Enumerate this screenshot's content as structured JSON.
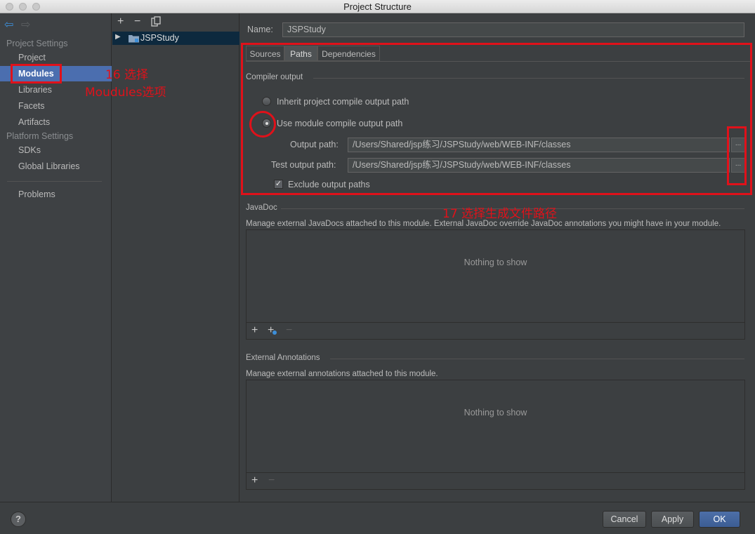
{
  "window": {
    "title": "Project Structure"
  },
  "sidebar": {
    "nav_back_icon": "back-arrow-icon",
    "nav_forward_icon": "forward-arrow-icon",
    "header_project_settings": "Project Settings",
    "header_platform_settings": "Platform Settings",
    "items": [
      {
        "label": "Project"
      },
      {
        "label": "Modules",
        "selected": true
      },
      {
        "label": "Libraries"
      },
      {
        "label": "Facets"
      },
      {
        "label": "Artifacts"
      },
      {
        "label": "SDKs"
      },
      {
        "label": "Global Libraries"
      },
      {
        "label": "Problems"
      }
    ]
  },
  "tree": {
    "add_label": "+",
    "remove_label": "−",
    "copy_icon": "copy-icon",
    "module_name": "JSPStudy"
  },
  "module": {
    "name_label": "Name:",
    "name_value": "JSPStudy"
  },
  "tabs": [
    {
      "label": "Sources"
    },
    {
      "label": "Paths",
      "active": true
    },
    {
      "label": "Dependencies"
    }
  ],
  "compiler_output": {
    "title": "Compiler output",
    "inherit_label": "Inherit project compile output path",
    "use_module_label": "Use module compile output path",
    "selected_option": "use_module",
    "output_path_label": "Output path:",
    "output_path_value": "/Users/Shared/jsp练习/JSPStudy/web/WEB-INF/classes",
    "test_output_path_label": "Test output path:",
    "test_output_path_value": "/Users/Shared/jsp练习/JSPStudy/web/WEB-INF/classes",
    "browse_label": "...",
    "exclude_label": "Exclude output paths",
    "exclude_checked": true
  },
  "javadoc": {
    "title": "JavaDoc",
    "description": "Manage external JavaDocs attached to this module. External JavaDoc override JavaDoc annotations you might have in your module.",
    "empty_text": "Nothing to show",
    "add_label": "+",
    "add_url_label": "+",
    "remove_label": "−"
  },
  "external_annotations": {
    "title": "External Annotations",
    "description": "Manage external annotations attached to this module.",
    "empty_text": "Nothing to show",
    "add_label": "+",
    "remove_label": "−"
  },
  "footer": {
    "help_label": "?",
    "cancel_label": "Cancel",
    "apply_label": "Apply",
    "ok_label": "OK"
  },
  "annotations": {
    "step16_line1": "16 选择",
    "step16_line2": "Moudules选项",
    "step17": "17 选择生成文件路径",
    "color": "#e0111a"
  }
}
